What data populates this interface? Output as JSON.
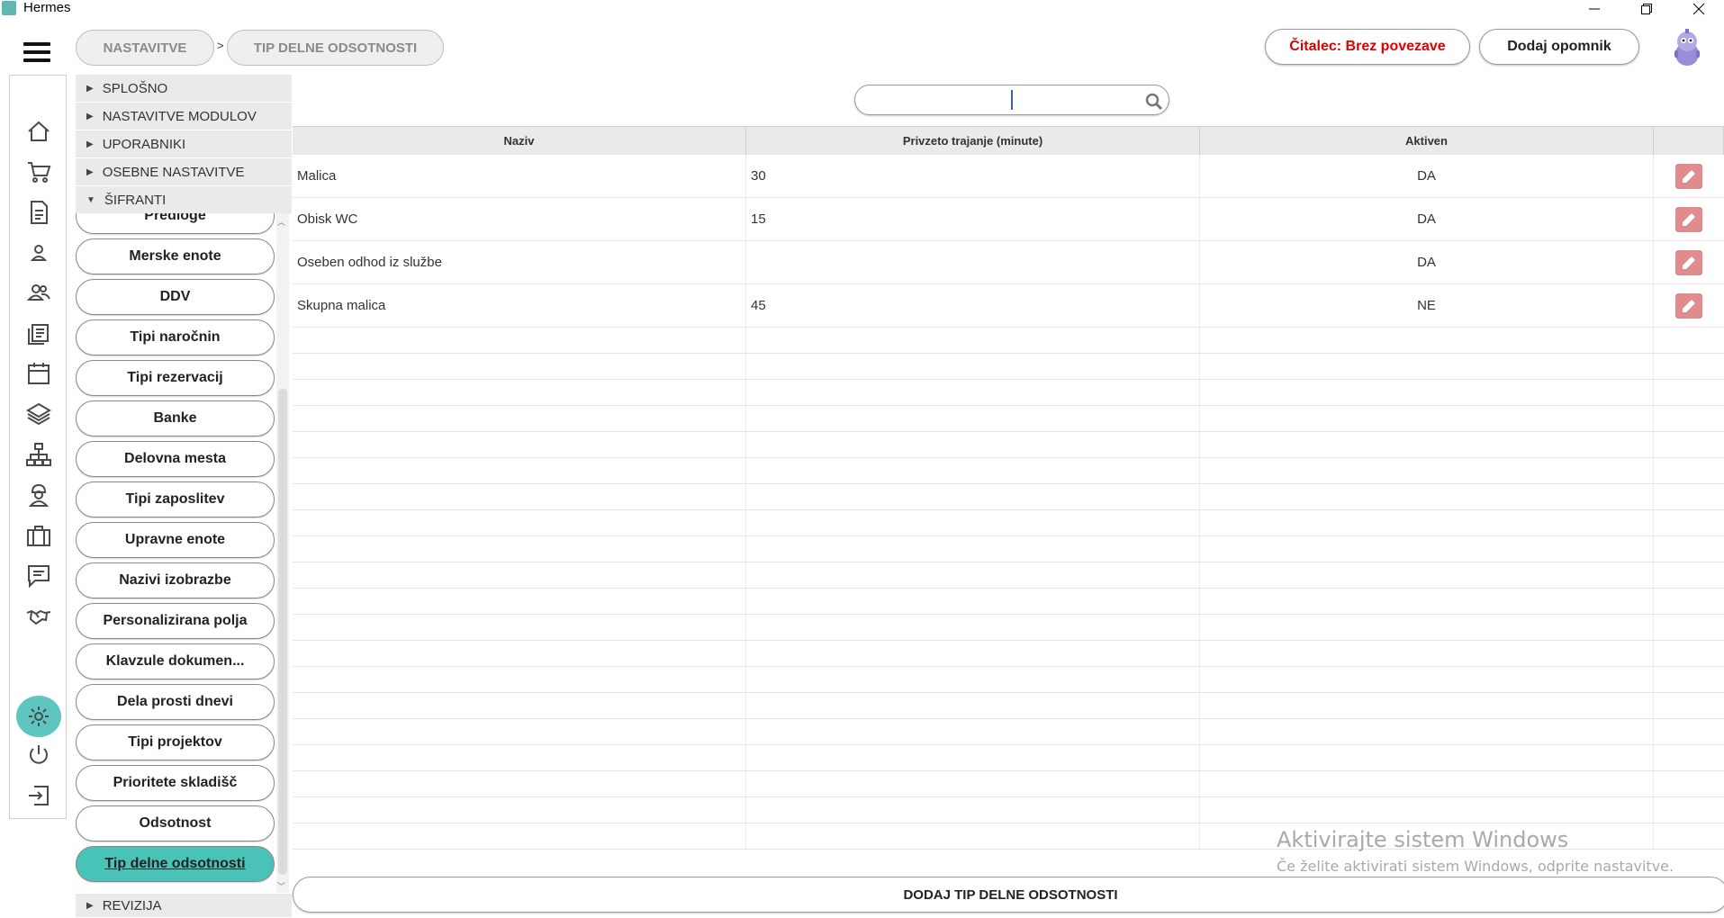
{
  "window": {
    "title": "Hermes"
  },
  "breadcrumb": {
    "root": "NASTAVITVE",
    "separator": ">",
    "current": "TIP DELNE ODSOTNOSTI"
  },
  "header": {
    "reader_status": "Čitalec: Brez povezave",
    "reader_status_color": "#e00000",
    "add_reminder": "Dodaj opomnik"
  },
  "rail_icons": [
    "home-icon",
    "cart-icon",
    "document-icon",
    "user-icon",
    "users-icon",
    "list-icon",
    "calendar-icon",
    "layers-icon",
    "network-icon",
    "worker-icon",
    "briefcase-icon",
    "chat-icon",
    "handshake-icon",
    "settings-icon",
    "power-icon",
    "logout-icon"
  ],
  "tree": {
    "sections": [
      {
        "label": "SPLOŠNO",
        "expanded": false
      },
      {
        "label": "NASTAVITVE MODULOV",
        "expanded": false
      },
      {
        "label": "UPORABNIKI",
        "expanded": false
      },
      {
        "label": "OSEBNE NASTAVITVE",
        "expanded": false
      },
      {
        "label": "ŠIFRANTI",
        "expanded": true
      }
    ],
    "items": [
      "Predloge",
      "Merske enote",
      "DDV",
      "Tipi naročnin",
      "Tipi rezervacij",
      "Banke",
      "Delovna mesta",
      "Tipi zaposlitev",
      "Upravne enote",
      "Nazivi izobrazbe",
      "Personalizirana polja",
      "Klavzule dokumen...",
      "Dela prosti dnevi",
      "Tipi projektov",
      "Prioritete skladišč",
      "Odsotnost",
      "Tip delne odsotnosti"
    ],
    "active_item": "Tip delne odsotnosti",
    "footer_section": "REVIZIJA"
  },
  "search": {
    "value": "",
    "placeholder": ""
  },
  "table": {
    "columns": [
      "Naziv",
      "Privzeto trajanje (minute)",
      "Aktiven",
      ""
    ],
    "rows": [
      {
        "name": "Malica",
        "duration": "30",
        "active": "DA"
      },
      {
        "name": "Obisk WC",
        "duration": "15",
        "active": "DA"
      },
      {
        "name": "Oseben odhod iz službe",
        "duration": "",
        "active": "DA"
      },
      {
        "name": "Skupna malica",
        "duration": "45",
        "active": "NE"
      }
    ]
  },
  "add_button": "DODAJ TIP DELNE ODSOTNOSTI",
  "watermark": {
    "title": "Aktivirajte sistem Windows",
    "subtitle": "Če želite aktivirati sistem Windows, odprite nastavitve."
  },
  "colors": {
    "accent": "#49c3b8",
    "edit_button": "#e08c8c"
  }
}
